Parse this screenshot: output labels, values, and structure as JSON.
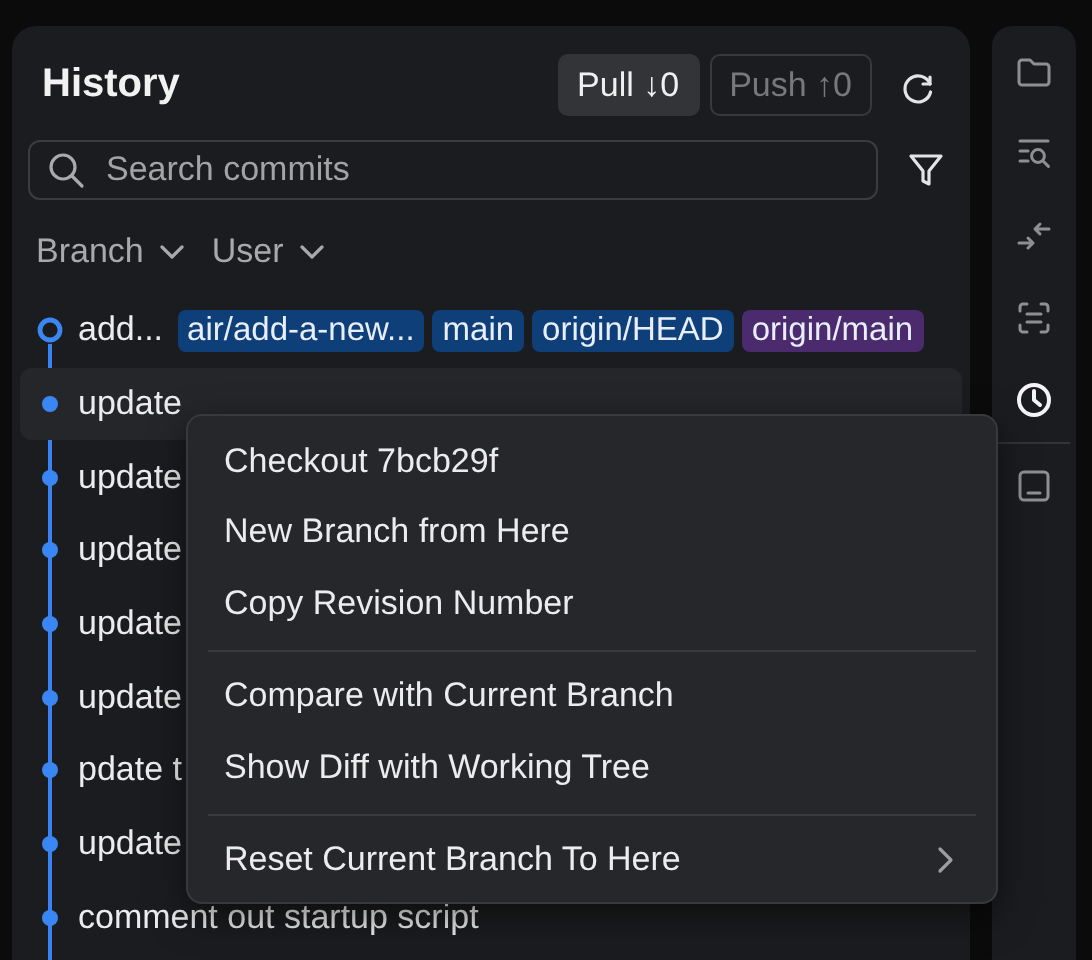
{
  "panel": {
    "title": "History",
    "buttons": [
      {
        "label": "Pull ↓0",
        "disabled": false
      },
      {
        "label": "Push ↑0",
        "disabled": true
      }
    ],
    "search": {
      "placeholder": "Search commits"
    },
    "filters": [
      {
        "label": "Branch"
      },
      {
        "label": "User"
      }
    ],
    "commits": [
      {
        "kind": "head",
        "message": "add...",
        "selected": false,
        "tags": [
          {
            "label": "air/add-a-new...",
            "color": "#0f3f78"
          },
          {
            "label": "main",
            "color": "#0f3f78"
          },
          {
            "label": "origin/HEAD",
            "color": "#0f3f78"
          },
          {
            "label": "origin/main",
            "color": "#4b2a6e"
          }
        ]
      },
      {
        "kind": "commit",
        "message": "update",
        "selected": true
      },
      {
        "kind": "commit",
        "message": "update",
        "selected": false
      },
      {
        "kind": "commit",
        "message": "update",
        "selected": false
      },
      {
        "kind": "commit",
        "message": "update",
        "selected": false
      },
      {
        "kind": "commit",
        "message": "update",
        "selected": false
      },
      {
        "kind": "commit",
        "message": "pdate t",
        "selected": false
      },
      {
        "kind": "commit",
        "message": "update",
        "selected": false
      },
      {
        "kind": "commit",
        "message": "comment out startup script",
        "selected": false
      }
    ]
  },
  "rail": {
    "groups": [
      [
        {
          "kind": "folder",
          "selected": false
        },
        {
          "kind": "search-list",
          "selected": false
        },
        {
          "kind": "collapse",
          "selected": false
        },
        {
          "kind": "scan",
          "selected": false
        },
        {
          "kind": "history",
          "selected": true
        }
      ],
      [
        {
          "kind": "terminal",
          "selected": false
        }
      ]
    ]
  },
  "context_menu": {
    "groups": [
      [
        {
          "label": "Checkout 7bcb29f",
          "has_submenu": false
        },
        {
          "label": "New Branch from Here",
          "has_submenu": false
        },
        {
          "label": "Copy Revision Number",
          "has_submenu": false
        }
      ],
      [
        {
          "label": "Compare with Current Branch",
          "has_submenu": false
        },
        {
          "label": "Show Diff with Working Tree",
          "has_submenu": false
        }
      ],
      [
        {
          "label": "Reset Current Branch To Here",
          "has_submenu": true
        }
      ]
    ]
  }
}
